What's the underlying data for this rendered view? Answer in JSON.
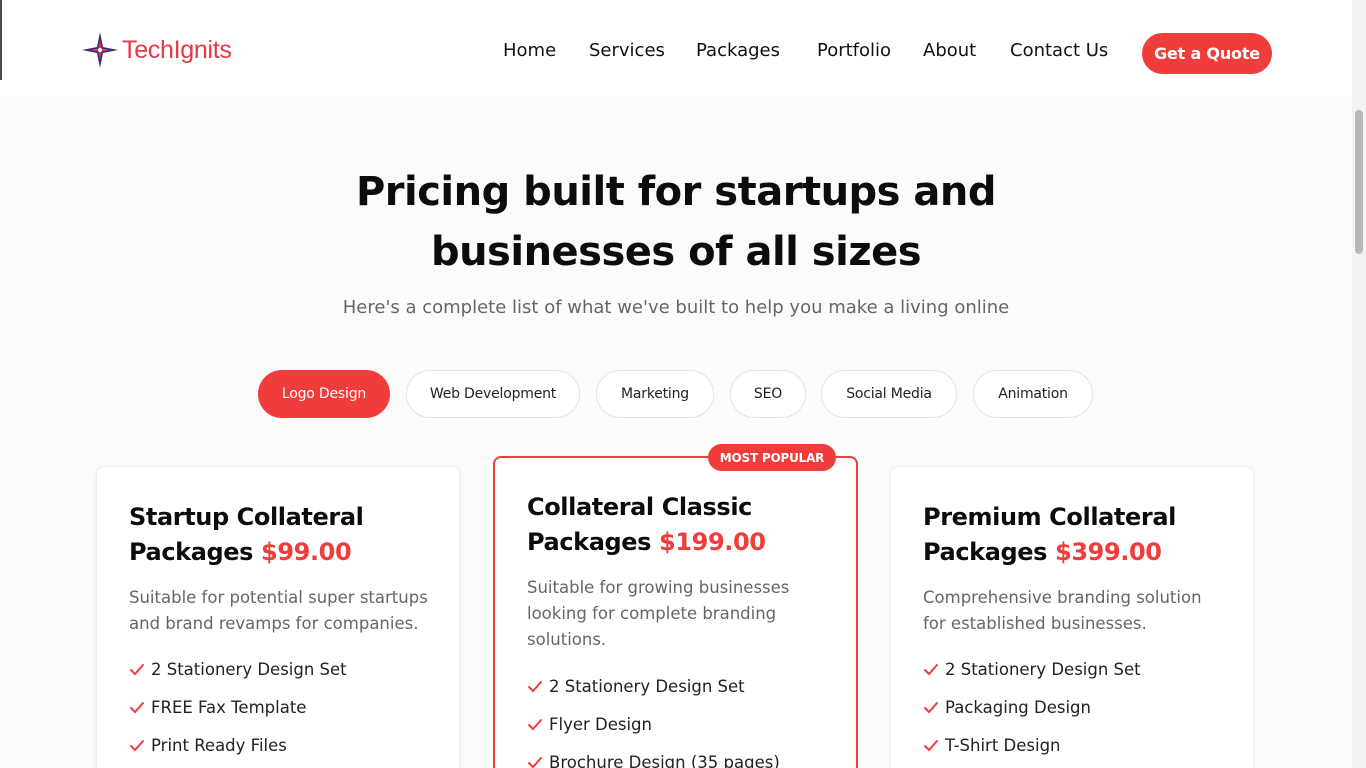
{
  "brand": {
    "name": "TechIgnits"
  },
  "nav": {
    "items": [
      "Home",
      "Services",
      "Packages",
      "Portfolio",
      "About",
      "Contact Us"
    ],
    "cta": "Get a Quote"
  },
  "hero": {
    "title_line1": "Pricing built for startups and",
    "title_line2": "businesses of all sizes",
    "subtitle": "Here's a complete list of what we've built to help you make a living online"
  },
  "tabs": [
    "Logo Design",
    "Web Development",
    "Marketing",
    "SEO",
    "Social Media",
    "Animation"
  ],
  "active_tab": "Logo Design",
  "badge": "MOST POPULAR",
  "cards": [
    {
      "title_line1": "Startup Collateral",
      "title_line2": "Packages",
      "price": "$99.00",
      "description": "Suitable for potential super startups and brand revamps for companies.",
      "features": [
        "2 Stationery Design Set",
        "FREE Fax Template",
        "Print Ready Files"
      ]
    },
    {
      "title_line1": "Collateral Classic",
      "title_line2": "Packages",
      "price": "$199.00",
      "description": "Suitable for growing businesses looking for complete branding solutions.",
      "features": [
        "2 Stationery Design Set",
        "Flyer Design",
        "Brochure Design (35 pages)"
      ]
    },
    {
      "title_line1": "Premium Collateral",
      "title_line2": "Packages",
      "price": "$399.00",
      "description": "Comprehensive branding solution for established businesses.",
      "features": [
        "2 Stationery Design Set",
        "Packaging Design",
        "T-Shirt Design"
      ]
    }
  ],
  "colors": {
    "accent": "#f13c3c",
    "brand_text": "#e63946",
    "logo_star": "#3b2a7a",
    "text_dark": "#0c0c0c",
    "text_muted": "#666666"
  }
}
